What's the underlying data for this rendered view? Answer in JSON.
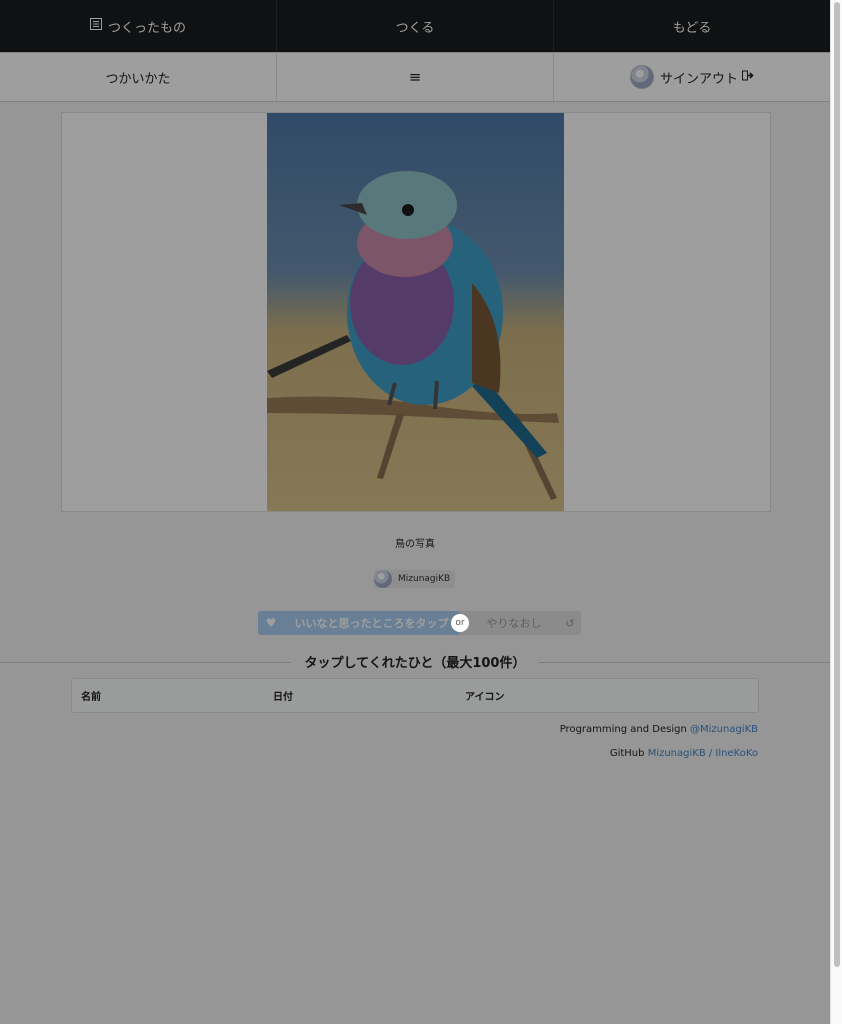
{
  "topnav": {
    "items": [
      {
        "label": "つくったもの",
        "icon": "list-icon"
      },
      {
        "label": "つくる"
      },
      {
        "label": "もどる"
      }
    ]
  },
  "menu": {
    "howto": "つかいかた",
    "hamburger": "≡",
    "signout": "サインアウト"
  },
  "post": {
    "caption": "鳥の写真",
    "author": "MizunagiKB"
  },
  "actions": {
    "like_label": "いいなと思ったところをタップ",
    "or": "or",
    "redo_label": "やりなおし"
  },
  "section": {
    "title": "タップしてくれたひと（最大100件）",
    "columns": [
      "名前",
      "日付",
      "アイコン"
    ]
  },
  "footer": {
    "programming_prefix": "Programming and Design ",
    "programming_link": "@MizunagiKB",
    "github_prefix": "GitHub ",
    "github_link": "MizunagiKB / IlneKoKo"
  },
  "colors": {
    "nav_bg": "#1b1c1d",
    "like_button": "#a8cdf0",
    "link": "#4183c4"
  }
}
